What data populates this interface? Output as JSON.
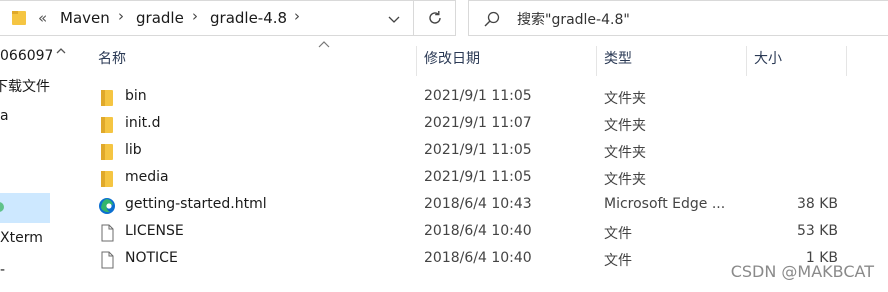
{
  "address_bar": {
    "overflow": "«",
    "crumbs": [
      "Maven",
      "gradle",
      "gradle-4.8"
    ],
    "separator": "›"
  },
  "search": {
    "placeholder": "搜索\"gradle-4.8\""
  },
  "nav": {
    "items": [
      {
        "label": "066097"
      },
      {
        "label": "下载文件"
      },
      {
        "label": "a"
      },
      {
        "label": ""
      },
      {
        "label": ""
      },
      {
        "label": "Xterm"
      },
      {
        "label": "-"
      }
    ]
  },
  "columns": {
    "name": "名称",
    "date": "修改日期",
    "type": "类型",
    "size": "大小"
  },
  "files": [
    {
      "name": "bin",
      "date": "2021/9/1 11:05",
      "type": "文件夹",
      "size": "",
      "icon": "folder-icon"
    },
    {
      "name": "init.d",
      "date": "2021/9/1 11:07",
      "type": "文件夹",
      "size": "",
      "icon": "folder-icon"
    },
    {
      "name": "lib",
      "date": "2021/9/1 11:05",
      "type": "文件夹",
      "size": "",
      "icon": "folder-icon"
    },
    {
      "name": "media",
      "date": "2021/9/1 11:05",
      "type": "文件夹",
      "size": "",
      "icon": "folder-icon"
    },
    {
      "name": "getting-started.html",
      "date": "2018/6/4 10:43",
      "type": "Microsoft Edge ...",
      "size": "38 KB",
      "icon": "edge-icon"
    },
    {
      "name": "LICENSE",
      "date": "2018/6/4 10:40",
      "type": "文件",
      "size": "53 KB",
      "icon": "file-icon"
    },
    {
      "name": "NOTICE",
      "date": "2018/6/4 10:40",
      "type": "文件",
      "size": "1 KB",
      "icon": "file-icon"
    }
  ],
  "watermark": "CSDN @MAKBCAT",
  "colors": {
    "folder": "#f5c542",
    "selection": "#cde8ff",
    "edge_blue": "#0c6fd0",
    "edge_green": "#3bc25a"
  }
}
